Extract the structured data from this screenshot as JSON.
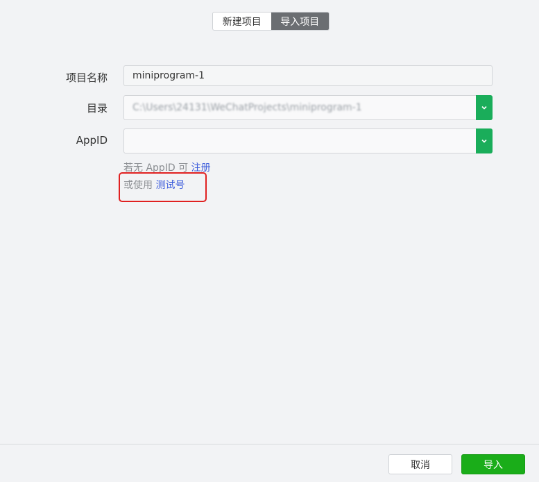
{
  "tabs": [
    {
      "label": "新建项目",
      "active": false
    },
    {
      "label": "导入项目",
      "active": true
    }
  ],
  "form": {
    "name_label": "项目名称",
    "name_value": "miniprogram-1",
    "dir_label": "目录",
    "dir_value": "C:\\Users\\24131\\WeChatProjects\\miniprogram-1",
    "appid_label": "AppID",
    "appid_value": ""
  },
  "hints": {
    "no_appid_prefix": "若无 AppID 可",
    "register_link": "注册",
    "or_use_prefix": "或使用",
    "test_account_link": "测试号"
  },
  "footer": {
    "cancel_label": "取消",
    "import_label": "导入"
  },
  "colors": {
    "accent_green": "#1aad19",
    "link_blue": "#3b5bdb",
    "highlight_red": "#e02020",
    "active_tab": "#6b6e72"
  }
}
